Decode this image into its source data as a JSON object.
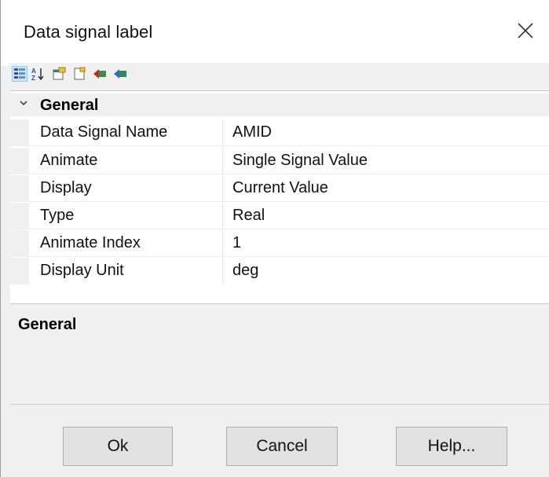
{
  "window": {
    "title": "Data signal label"
  },
  "toolbar": {
    "buttons": [
      {
        "icon": "categorized-icon",
        "active": true
      },
      {
        "icon": "alphabetical-sort-icon"
      },
      {
        "icon": "property-pages-icon"
      },
      {
        "icon": "new-page-icon"
      },
      {
        "icon": "import-icon"
      },
      {
        "icon": "export-icon"
      }
    ]
  },
  "grid": {
    "category": "General",
    "properties": [
      {
        "name": "Data Signal Name",
        "value": "AMID"
      },
      {
        "name": "Animate",
        "value": "Single Signal Value"
      },
      {
        "name": "Display",
        "value": "Current Value"
      },
      {
        "name": "Type",
        "value": "Real"
      },
      {
        "name": "Animate Index",
        "value": "1"
      },
      {
        "name": "Display Unit",
        "value": "deg"
      }
    ]
  },
  "description": {
    "title": "General"
  },
  "buttons": {
    "ok": "Ok",
    "cancel": "Cancel",
    "help": "Help..."
  }
}
